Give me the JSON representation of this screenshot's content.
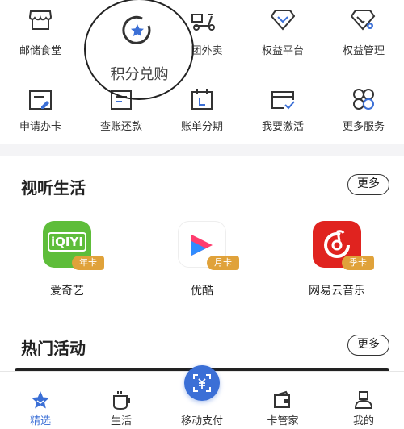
{
  "top_grid": {
    "row1": [
      {
        "label": "邮储食堂",
        "icon": "shop-icon"
      },
      {
        "label": "积分兑购",
        "icon": "points-star-icon"
      },
      {
        "label": "团外卖",
        "icon": "scooter-icon"
      },
      {
        "label": "权益平台",
        "icon": "diamond-icon"
      },
      {
        "label": "权益管理",
        "icon": "diamond-gear-icon"
      }
    ],
    "row2": [
      {
        "label": "申请办卡",
        "icon": "card-edit-icon"
      },
      {
        "label": "查账还款",
        "icon": "bill-icon"
      },
      {
        "label": "账单分期",
        "icon": "calendar-icon"
      },
      {
        "label": "我要激活",
        "icon": "card-check-icon"
      },
      {
        "label": "更多服务",
        "icon": "grid-more-icon"
      }
    ]
  },
  "video_section": {
    "title": "视听生活",
    "more_label": "更多",
    "apps": [
      {
        "name": "爱奇艺",
        "badge": "年卡",
        "logo_text": "iQIYI",
        "color": "#5ebd3a"
      },
      {
        "name": "优酷",
        "badge": "月卡",
        "color": "#ffffff"
      },
      {
        "name": "网易云音乐",
        "badge": "季卡",
        "color": "#e0231f"
      }
    ]
  },
  "hot_section": {
    "title": "热门活动",
    "more_label": "更多"
  },
  "tabbar": {
    "items": [
      {
        "label": "精选",
        "icon": "star-icon"
      },
      {
        "label": "生活",
        "icon": "cup-icon"
      },
      {
        "label": "移动支付",
        "icon": "scan-pay-icon"
      },
      {
        "label": "卡管家",
        "icon": "wallet-icon"
      },
      {
        "label": "我的",
        "icon": "person-icon"
      }
    ],
    "active_color": "#3b6fd6"
  }
}
